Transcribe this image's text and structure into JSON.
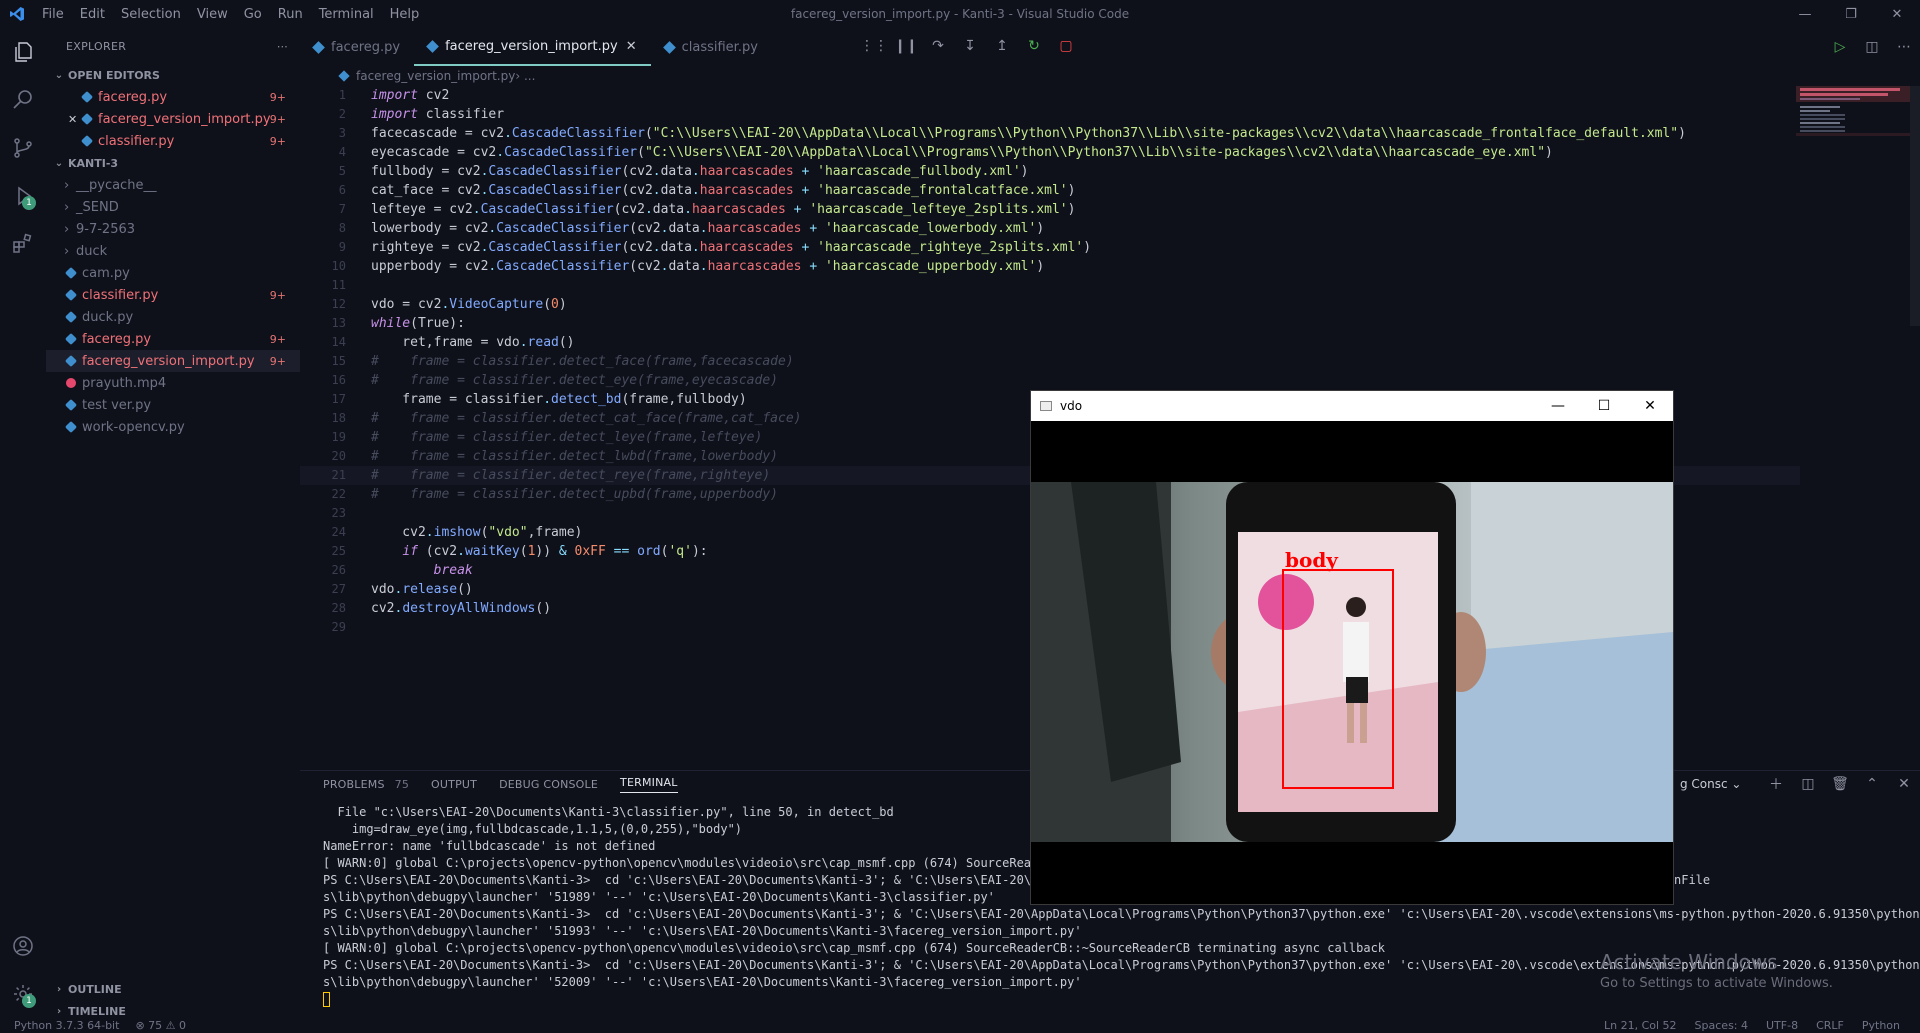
{
  "titlebar": {
    "menu": [
      "File",
      "Edit",
      "Selection",
      "View",
      "Go",
      "Run",
      "Terminal",
      "Help"
    ],
    "title": "facereg_version_import.py - Kanti-3 - Visual Studio Code"
  },
  "activity": {
    "debug_badge": "1",
    "settings_badge": "1"
  },
  "sidebar": {
    "header": "EXPLORER",
    "open_editors_label": "OPEN EDITORS",
    "open_editors": [
      {
        "name": "facereg.py",
        "badge": "9+",
        "close": ""
      },
      {
        "name": "facereg_version_import.py",
        "badge": "9+",
        "close": "✕"
      },
      {
        "name": "classifier.py",
        "badge": "9+",
        "close": ""
      }
    ],
    "project_label": "KANTI-3",
    "folders": [
      "__pycache__",
      "_SEND",
      "9-7-2563",
      "duck"
    ],
    "files": [
      {
        "name": "cam.py",
        "badge": "",
        "kind": "py",
        "status": "gray"
      },
      {
        "name": "classifier.py",
        "badge": "9+",
        "kind": "py",
        "status": "red"
      },
      {
        "name": "duck.py",
        "badge": "",
        "kind": "py",
        "status": "gray"
      },
      {
        "name": "facereg.py",
        "badge": "9+",
        "kind": "py",
        "status": "red"
      },
      {
        "name": "facereg_version_import.py",
        "badge": "9+",
        "kind": "py",
        "status": "red"
      },
      {
        "name": "prayuth.mp4",
        "badge": "",
        "kind": "mp4",
        "status": "gray"
      },
      {
        "name": "test ver.py",
        "badge": "",
        "kind": "py",
        "status": "gray"
      },
      {
        "name": "work-opencv.py",
        "badge": "",
        "kind": "py",
        "status": "gray"
      }
    ],
    "outline_label": "OUTLINE",
    "timeline_label": "TIMELINE"
  },
  "tabs": [
    {
      "name": "facereg.py",
      "active": false
    },
    {
      "name": "facereg_version_import.py",
      "active": true
    },
    {
      "name": "classifier.py",
      "active": false
    }
  ],
  "tab_close": "✕",
  "breadcrumb": {
    "file": "facereg_version_import.py",
    "rest": " › ..."
  },
  "code_lines": [
    [
      [
        "import",
        "#c792ea",
        1
      ],
      [
        " cv2",
        "#c9ccd6",
        0
      ]
    ],
    [
      [
        "import",
        "#c792ea",
        1
      ],
      [
        " classifier",
        "#c9ccd6",
        0
      ]
    ],
    [
      [
        "facecascade = ",
        "#c9ccd6",
        0
      ],
      [
        "cv2",
        "#c9ccd6",
        0
      ],
      [
        ".",
        "#89ddff",
        0
      ],
      [
        "CascadeClassifier",
        "#82aaff",
        0
      ],
      [
        "(",
        "#c9ccd6",
        0
      ],
      [
        "\"C:\\\\Users\\\\EAI-20\\\\AppData\\\\Local\\\\Programs\\\\Python\\\\Python37\\\\Lib\\\\site-packages\\\\cv2\\\\data\\\\haarcascade_frontalface_default.xml\"",
        "#c3e88d",
        0
      ],
      [
        ")",
        "#c9ccd6",
        0
      ]
    ],
    [
      [
        "eyecascade = ",
        "#c9ccd6",
        0
      ],
      [
        "cv2",
        "#c9ccd6",
        0
      ],
      [
        ".",
        "#89ddff",
        0
      ],
      [
        "CascadeClassifier",
        "#82aaff",
        0
      ],
      [
        "(",
        "#c9ccd6",
        0
      ],
      [
        "\"C:\\\\Users\\\\EAI-20\\\\AppData\\\\Local\\\\Programs\\\\Python\\\\Python37\\\\Lib\\\\site-packages\\\\cv2\\\\data\\\\haarcascade_eye.xml\"",
        "#c3e88d",
        0
      ],
      [
        ")",
        "#c9ccd6",
        0
      ]
    ],
    [
      [
        "fullbody = ",
        "#c9ccd6",
        0
      ],
      [
        "cv2",
        "#c9ccd6",
        0
      ],
      [
        ".",
        "#89ddff",
        0
      ],
      [
        "CascadeClassifier",
        "#82aaff",
        0
      ],
      [
        "(",
        "#c9ccd6",
        0
      ],
      [
        "cv2",
        "#c9ccd6",
        0
      ],
      [
        ".",
        "#89ddff",
        0
      ],
      [
        "data",
        "#c9ccd6",
        0
      ],
      [
        ".",
        "#89ddff",
        0
      ],
      [
        "haarcascades",
        "#f07178",
        0
      ],
      [
        " + ",
        "#89ddff",
        0
      ],
      [
        "'haarcascade_fullbody.xml'",
        "#c3e88d",
        0
      ],
      [
        ")",
        "#c9ccd6",
        0
      ]
    ],
    [
      [
        "cat_face = ",
        "#c9ccd6",
        0
      ],
      [
        "cv2",
        "#c9ccd6",
        0
      ],
      [
        ".",
        "#89ddff",
        0
      ],
      [
        "CascadeClassifier",
        "#82aaff",
        0
      ],
      [
        "(",
        "#c9ccd6",
        0
      ],
      [
        "cv2",
        "#c9ccd6",
        0
      ],
      [
        ".",
        "#89ddff",
        0
      ],
      [
        "data",
        "#c9ccd6",
        0
      ],
      [
        ".",
        "#89ddff",
        0
      ],
      [
        "haarcascades",
        "#f07178",
        0
      ],
      [
        " + ",
        "#89ddff",
        0
      ],
      [
        "'haarcascade_frontalcatface.xml'",
        "#c3e88d",
        0
      ],
      [
        ")",
        "#c9ccd6",
        0
      ]
    ],
    [
      [
        "lefteye = ",
        "#c9ccd6",
        0
      ],
      [
        "cv2",
        "#c9ccd6",
        0
      ],
      [
        ".",
        "#89ddff",
        0
      ],
      [
        "CascadeClassifier",
        "#82aaff",
        0
      ],
      [
        "(",
        "#c9ccd6",
        0
      ],
      [
        "cv2",
        "#c9ccd6",
        0
      ],
      [
        ".",
        "#89ddff",
        0
      ],
      [
        "data",
        "#c9ccd6",
        0
      ],
      [
        ".",
        "#89ddff",
        0
      ],
      [
        "haarcascades",
        "#f07178",
        0
      ],
      [
        " + ",
        "#89ddff",
        0
      ],
      [
        "'haarcascade_lefteye_2splits.xml'",
        "#c3e88d",
        0
      ],
      [
        ")",
        "#c9ccd6",
        0
      ]
    ],
    [
      [
        "lowerbody = ",
        "#c9ccd6",
        0
      ],
      [
        "cv2",
        "#c9ccd6",
        0
      ],
      [
        ".",
        "#89ddff",
        0
      ],
      [
        "CascadeClassifier",
        "#82aaff",
        0
      ],
      [
        "(",
        "#c9ccd6",
        0
      ],
      [
        "cv2",
        "#c9ccd6",
        0
      ],
      [
        ".",
        "#89ddff",
        0
      ],
      [
        "data",
        "#c9ccd6",
        0
      ],
      [
        ".",
        "#89ddff",
        0
      ],
      [
        "haarcascades",
        "#f07178",
        0
      ],
      [
        " + ",
        "#89ddff",
        0
      ],
      [
        "'haarcascade_lowerbody.xml'",
        "#c3e88d",
        0
      ],
      [
        ")",
        "#c9ccd6",
        0
      ]
    ],
    [
      [
        "righteye = ",
        "#c9ccd6",
        0
      ],
      [
        "cv2",
        "#c9ccd6",
        0
      ],
      [
        ".",
        "#89ddff",
        0
      ],
      [
        "CascadeClassifier",
        "#82aaff",
        0
      ],
      [
        "(",
        "#c9ccd6",
        0
      ],
      [
        "cv2",
        "#c9ccd6",
        0
      ],
      [
        ".",
        "#89ddff",
        0
      ],
      [
        "data",
        "#c9ccd6",
        0
      ],
      [
        ".",
        "#89ddff",
        0
      ],
      [
        "haarcascades",
        "#f07178",
        0
      ],
      [
        " + ",
        "#89ddff",
        0
      ],
      [
        "'haarcascade_righteye_2splits.xml'",
        "#c3e88d",
        0
      ],
      [
        ")",
        "#c9ccd6",
        0
      ]
    ],
    [
      [
        "upperbody = ",
        "#c9ccd6",
        0
      ],
      [
        "cv2",
        "#c9ccd6",
        0
      ],
      [
        ".",
        "#89ddff",
        0
      ],
      [
        "CascadeClassifier",
        "#82aaff",
        0
      ],
      [
        "(",
        "#c9ccd6",
        0
      ],
      [
        "cv2",
        "#c9ccd6",
        0
      ],
      [
        ".",
        "#89ddff",
        0
      ],
      [
        "data",
        "#c9ccd6",
        0
      ],
      [
        ".",
        "#89ddff",
        0
      ],
      [
        "haarcascades",
        "#f07178",
        0
      ],
      [
        " + ",
        "#89ddff",
        0
      ],
      [
        "'haarcascade_upperbody.xml'",
        "#c3e88d",
        0
      ],
      [
        ")",
        "#c9ccd6",
        0
      ]
    ],
    [],
    [
      [
        "vdo = ",
        "#c9ccd6",
        0
      ],
      [
        "cv2",
        "#c9ccd6",
        0
      ],
      [
        ".",
        "#89ddff",
        0
      ],
      [
        "VideoCapture",
        "#82aaff",
        0
      ],
      [
        "(",
        "#c9ccd6",
        0
      ],
      [
        "0",
        "#f78c6c",
        0
      ],
      [
        ")",
        "#c9ccd6",
        0
      ]
    ],
    [
      [
        "while",
        "#c792ea",
        1
      ],
      [
        "(",
        "#c9ccd6",
        0
      ],
      [
        "True",
        "#c9ccd6",
        0
      ],
      [
        "):",
        "#c9ccd6",
        0
      ]
    ],
    [
      [
        "    ret,frame = vdo",
        "#c9ccd6",
        0
      ],
      [
        ".",
        "#89ddff",
        0
      ],
      [
        "read",
        "#82aaff",
        0
      ],
      [
        "()",
        "#c9ccd6",
        0
      ]
    ],
    [
      [
        "#    frame = classifier.detect_face(frame,facecascade)",
        "#464b5d",
        1
      ]
    ],
    [
      [
        "#    frame = classifier.detect_eye(frame,eyecascade)",
        "#464b5d",
        1
      ]
    ],
    [
      [
        "    frame = classifier",
        "#c9ccd6",
        0
      ],
      [
        ".",
        "#89ddff",
        0
      ],
      [
        "detect_bd",
        "#82aaff",
        0
      ],
      [
        "(frame,fullbody)",
        "#c9ccd6",
        0
      ]
    ],
    [
      [
        "#    frame = classifier.detect_cat_face(frame,cat_face)",
        "#464b5d",
        1
      ]
    ],
    [
      [
        "#    frame = classifier.detect_leye(frame,lefteye)",
        "#464b5d",
        1
      ]
    ],
    [
      [
        "#    frame = classifier.detect_lwbd(frame,lowerbody)",
        "#464b5d",
        1
      ]
    ],
    [
      [
        "#    frame = classifier.detect_reye(frame,righteye)",
        "#464b5d",
        1
      ]
    ],
    [
      [
        "#    frame = classifier.detect_upbd(frame,upperbody)",
        "#464b5d",
        1
      ]
    ],
    [],
    [
      [
        "    cv2",
        "#c9ccd6",
        0
      ],
      [
        ".",
        "#89ddff",
        0
      ],
      [
        "imshow",
        "#82aaff",
        0
      ],
      [
        "(",
        "#c9ccd6",
        0
      ],
      [
        "\"vdo\"",
        "#c3e88d",
        0
      ],
      [
        ",frame)",
        "#c9ccd6",
        0
      ]
    ],
    [
      [
        "    ",
        "#c9ccd6",
        0
      ],
      [
        "if",
        "#c792ea",
        1
      ],
      [
        " (cv2",
        "#c9ccd6",
        0
      ],
      [
        ".",
        "#89ddff",
        0
      ],
      [
        "waitKey",
        "#82aaff",
        0
      ],
      [
        "(",
        "#c9ccd6",
        0
      ],
      [
        "1",
        "#f78c6c",
        0
      ],
      [
        ")) ",
        "#c9ccd6",
        0
      ],
      [
        "&",
        "#89ddff",
        0
      ],
      [
        " ",
        "#c9ccd6",
        0
      ],
      [
        "0xFF",
        "#f78c6c",
        0
      ],
      [
        " == ",
        "#89ddff",
        0
      ],
      [
        "ord",
        "#82aaff",
        0
      ],
      [
        "(",
        "#c9ccd6",
        0
      ],
      [
        "'q'",
        "#c3e88d",
        0
      ],
      [
        "):",
        "#c9ccd6",
        0
      ]
    ],
    [
      [
        "        ",
        "#c9ccd6",
        0
      ],
      [
        "break",
        "#c792ea",
        1
      ]
    ],
    [
      [
        "vdo",
        "#c9ccd6",
        0
      ],
      [
        ".",
        "#89ddff",
        0
      ],
      [
        "release",
        "#82aaff",
        0
      ],
      [
        "()",
        "#c9ccd6",
        0
      ]
    ],
    [
      [
        "cv2",
        "#c9ccd6",
        0
      ],
      [
        ".",
        "#89ddff",
        0
      ],
      [
        "destroyAllWindows",
        "#82aaff",
        0
      ],
      [
        "()",
        "#c9ccd6",
        0
      ]
    ],
    []
  ],
  "panel": {
    "tabs": [
      {
        "label": "PROBLEMS",
        "count": "75",
        "active": false
      },
      {
        "label": "OUTPUT",
        "count": "",
        "active": false
      },
      {
        "label": "DEBUG CONSOLE",
        "count": "",
        "active": false
      },
      {
        "label": "TERMINAL",
        "count": "",
        "active": true
      }
    ],
    "terminal_select": "g Consc",
    "terminal_lines": [
      "  File \"c:\\Users\\EAI-20\\Documents\\Kanti-3\\classifier.py\", line 50, in detect_bd",
      "    img=draw_eye(img,fullbdcascade,1.1,5,(0,0,255),\"body\")",
      "NameError: name 'fullbdcascade' is not defined",
      "[ WARN:0] global C:\\projects\\opencv-python\\opencv\\modules\\videoio\\src\\cap_msmf.cpp (674) SourceReader",
      "PS C:\\Users\\EAI-20\\Documents\\Kanti-3>  cd 'c:\\Users\\EAI-20\\Documents\\Kanti-3'; & 'C:\\Users\\EAI-20\\App                                                          on.python-2020.6.91350\\pythonFile",
      "s\\lib\\python\\debugpy\\launcher' '51989' '--' 'c:\\Users\\EAI-20\\Documents\\Kanti-3\\classifier.py'",
      "PS C:\\Users\\EAI-20\\Documents\\Kanti-3>  cd 'c:\\Users\\EAI-20\\Documents\\Kanti-3'; & 'C:\\Users\\EAI-20\\AppData\\Local\\Programs\\Python\\Python37\\python.exe' 'c:\\Users\\EAI-20\\.vscode\\extensions\\ms-python.python-2020.6.91350\\pythonFile",
      "s\\lib\\python\\debugpy\\launcher' '51993' '--' 'c:\\Users\\EAI-20\\Documents\\Kanti-3\\facereg_version_import.py'",
      "[ WARN:0] global C:\\projects\\opencv-python\\opencv\\modules\\videoio\\src\\cap_msmf.cpp (674) SourceReaderCB::~SourceReaderCB terminating async callback",
      "PS C:\\Users\\EAI-20\\Documents\\Kanti-3>  cd 'c:\\Users\\EAI-20\\Documents\\Kanti-3'; & 'C:\\Users\\EAI-20\\AppData\\Local\\Programs\\Python\\Python37\\python.exe' 'c:\\Users\\EAI-20\\.vscode\\extensions\\ms-python.python-2020.6.91350\\pythonFile",
      "s\\lib\\python\\debugpy\\launcher' '52009' '--' 'c:\\Users\\EAI-20\\Documents\\Kanti-3\\facereg_version_import.py'"
    ]
  },
  "activate_windows": {
    "line1": "Activate Windows",
    "line2": "Go to Settings to activate Windows."
  },
  "statusbar": {
    "python": "Python 3.7.3 64-bit",
    "problems": "⊗ 75 ⚠ 0",
    "position": "Ln 21, Col 52",
    "spaces": "Spaces: 4",
    "encoding": "UTF-8",
    "eol": "CRLF",
    "language": "Python"
  },
  "vdo_window": {
    "title": "vdo",
    "detection_label": "body"
  },
  "colors": {
    "accent": "#80cbc4",
    "error": "#f07178",
    "bg": "#0f111a"
  }
}
